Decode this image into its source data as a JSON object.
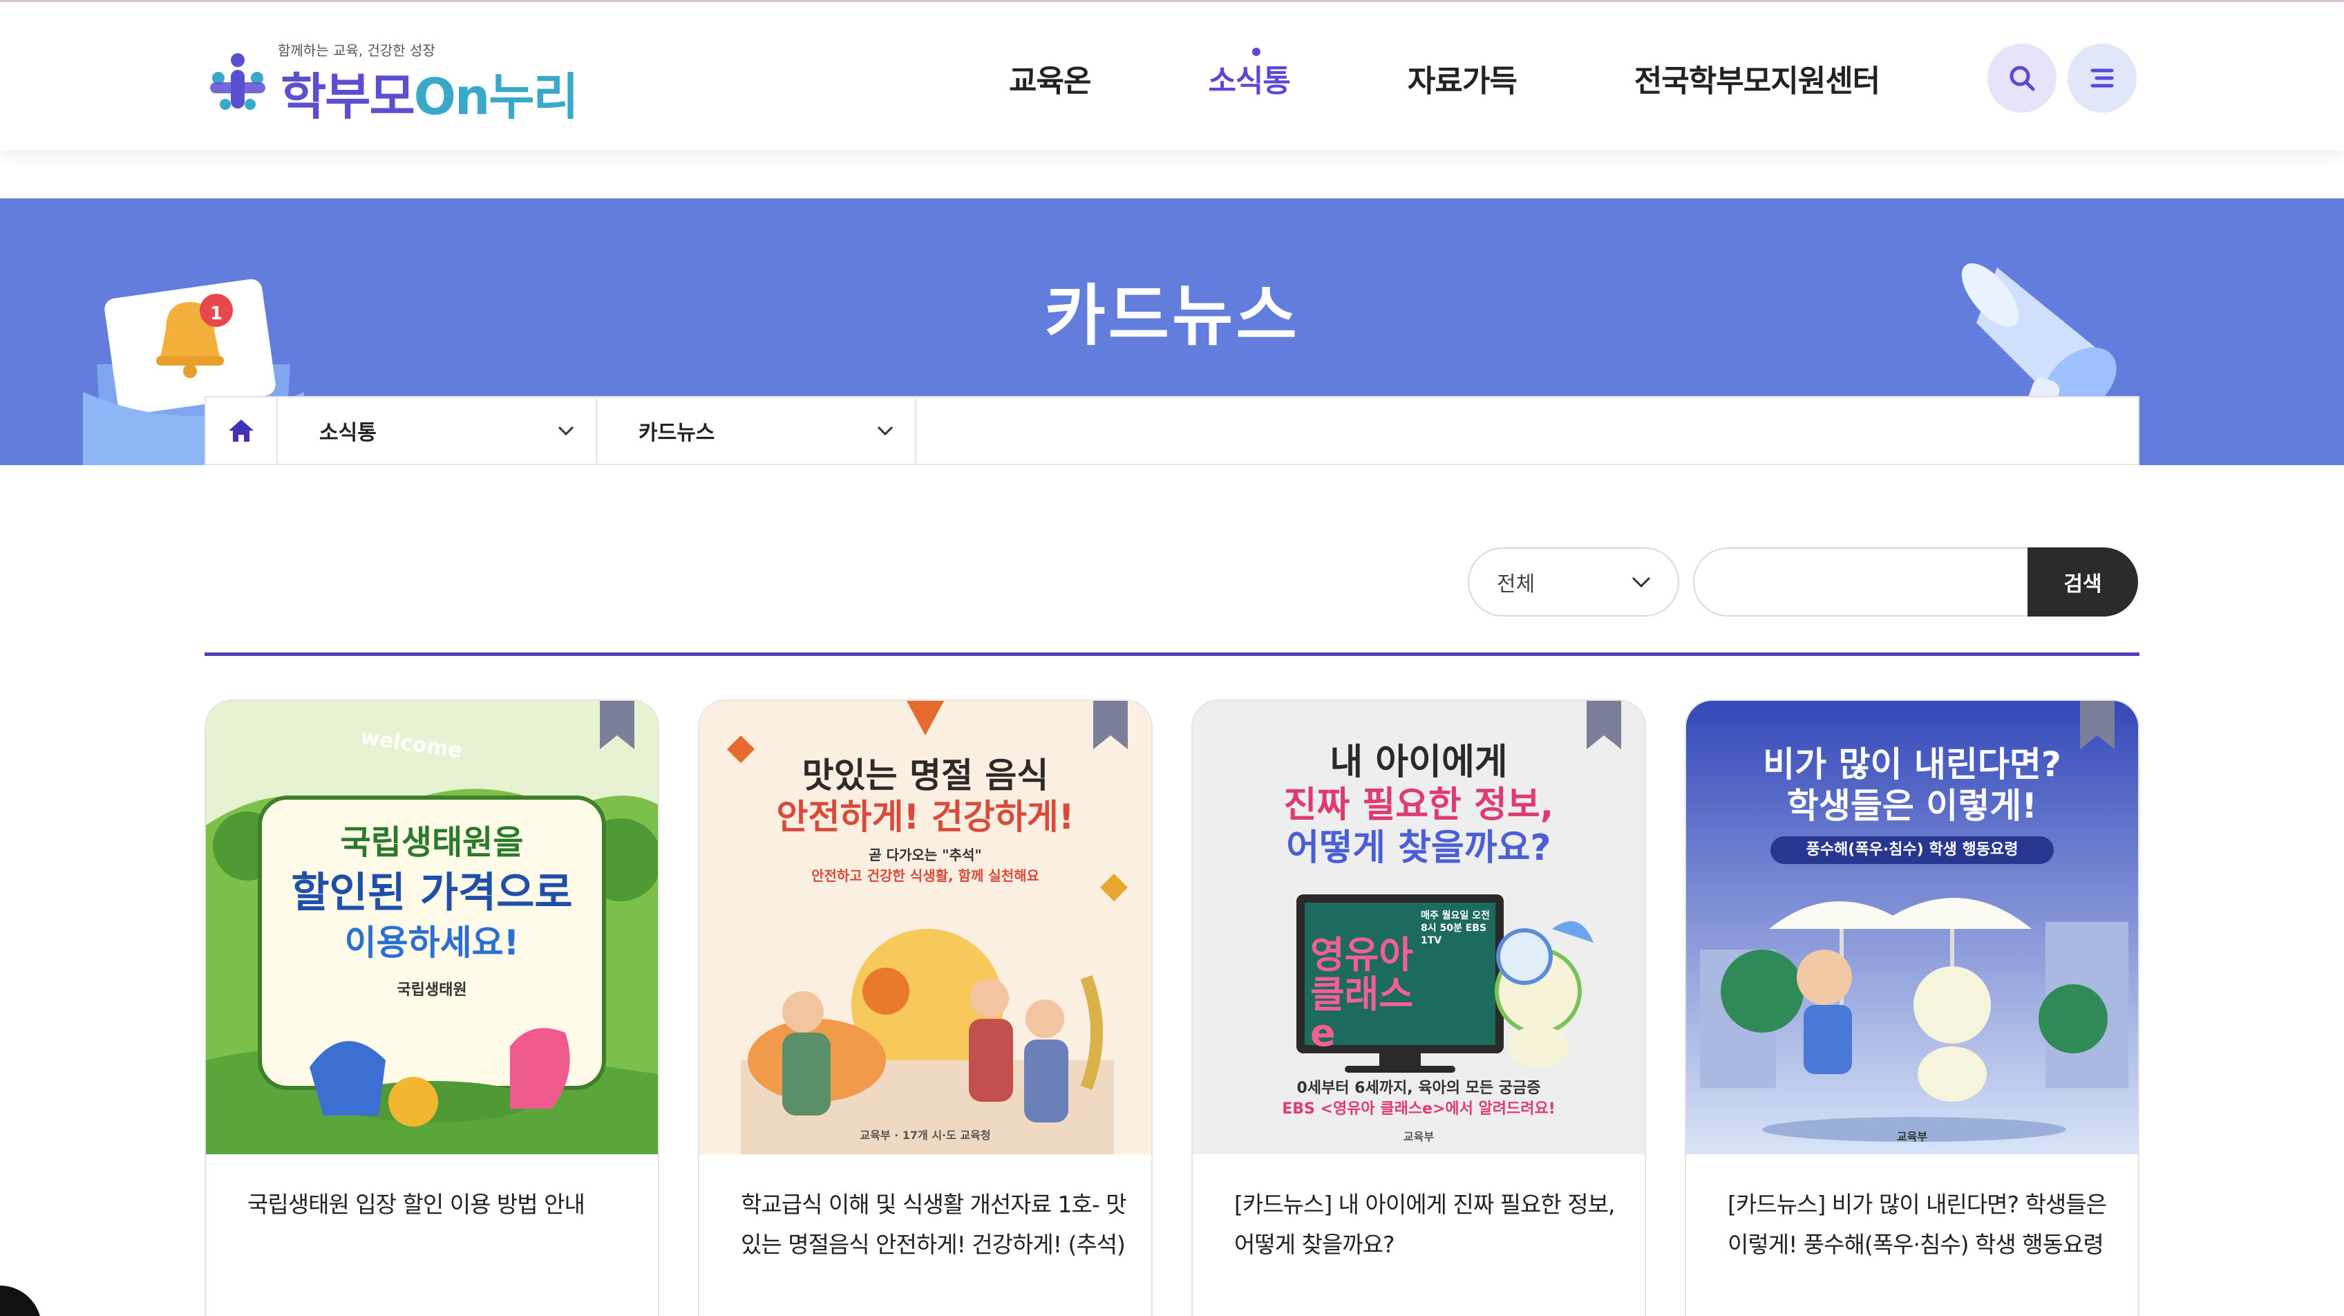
{
  "header": {
    "logo_tagline": "함께하는 교육, 건강한 성장",
    "logo_main": "학부모",
    "logo_sub": "On누리",
    "nav": [
      {
        "label": "교육온",
        "active": false
      },
      {
        "label": "소식통",
        "active": true
      },
      {
        "label": "자료가득",
        "active": false
      },
      {
        "label": "전국학부모지원센터",
        "active": false
      }
    ],
    "search_icon": "search-icon",
    "menu_icon": "menu-icon"
  },
  "hero": {
    "title": "카드뉴스",
    "notification_count": "1"
  },
  "breadcrumb": {
    "home_icon": "home-icon",
    "level1": "소식통",
    "level2": "카드뉴스"
  },
  "search": {
    "category_selected": "전체",
    "input_value": "",
    "button_label": "검색"
  },
  "colors": {
    "hero_bg": "#637ddc",
    "accent": "#5849d6",
    "divider": "#4b40b8",
    "search_button": "#2b2b2b"
  },
  "cards": [
    {
      "image_lines": [
        "국립생태원을",
        "할인된 가격으로",
        "이용하세요!"
      ],
      "image_badge": "welcome",
      "image_org": "국립생태원",
      "title": "국립생태원 입장 할인 이용 방법 안내"
    },
    {
      "image_lines": [
        "맛있는 명절 음식",
        "안전하게! 건강하게!"
      ],
      "image_sub1": "곧 다가오는 \"추석\"",
      "image_sub2": "안전하고 건강한 식생활, 함께 실천해요",
      "image_org": "교육부 · 17개 시·도 교육청",
      "title": "학교급식 이해 및 식생활 개선자료 1호- 맛있는 명절음식 안전하게! 건강하게! (추석)"
    },
    {
      "image_lines": [
        "내 아이에게",
        "진짜 필요한 정보,",
        "어떻게 찾을까요?"
      ],
      "image_tv": "영유아 클래스e",
      "image_schedule": "매주 월요일 오전 8시 50분 EBS 1TV",
      "image_foot1": "0세부터 6세까지, 육아의 모든 궁금증",
      "image_foot2": "EBS <영유아 클래스e>에서 알려드려요!",
      "image_org": "교육부",
      "title": "[카드뉴스] 내 아이에게 진짜 필요한 정보, 어떻게 찾을까요?"
    },
    {
      "image_lines": [
        "비가 많이 내린다면?",
        "학생들은 이렇게!"
      ],
      "image_pill": "풍수해(폭우·침수) 학생 행동요령",
      "image_org": "교육부",
      "title": "[카드뉴스] 비가 많이 내린다면? 학생들은 이렇게! 풍수해(폭우·침수) 학생 행동요령"
    }
  ]
}
